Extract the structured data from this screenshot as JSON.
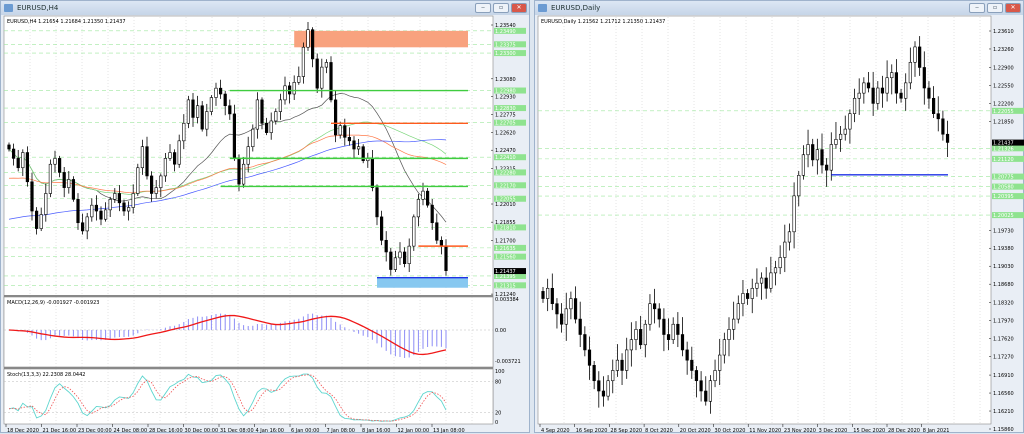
{
  "left": {
    "title": "EURUSD,H4",
    "header": "EURUSD,H4  1.21654 1.21684 1.21350 1.21437",
    "price_labels": [
      "1.23540",
      "1.23080",
      "1.22930",
      "1.22775",
      "1.22620",
      "1.22470",
      "1.22315",
      "1.22010",
      "1.21855",
      "1.21700",
      "1.21240"
    ],
    "price_values": [
      1.2354,
      1.2308,
      1.2293,
      1.22775,
      1.2262,
      1.2247,
      1.22315,
      1.2201,
      1.21855,
      1.217,
      1.2124
    ],
    "level_labels": [
      "1.23490",
      "1.23375",
      "1.23300",
      "1.22980",
      "1.22830",
      "1.22705",
      "1.22410",
      "1.22280",
      "1.22170",
      "1.22055",
      "1.21810",
      "1.21635",
      "1.21560",
      "1.21395",
      "1.21315"
    ],
    "level_values": [
      1.2349,
      1.23375,
      1.233,
      1.2298,
      1.2283,
      1.22705,
      1.2241,
      1.2228,
      1.2217,
      1.22055,
      1.2181,
      1.21635,
      1.2156,
      1.21395,
      1.21315
    ],
    "current_price": "1.21437",
    "closes": [
      1.2248,
      1.224,
      1.2232,
      1.2245,
      1.222,
      1.2195,
      1.218,
      1.2192,
      1.221,
      1.2235,
      1.224,
      1.2228,
      1.2215,
      1.2222,
      1.2205,
      1.2185,
      1.2178,
      1.219,
      1.22,
      1.2195,
      1.2188,
      1.2196,
      1.2205,
      1.221,
      1.2202,
      1.2195,
      1.2198,
      1.221,
      1.2232,
      1.225,
      1.2225,
      1.221,
      1.2215,
      1.2225,
      1.224,
      1.2245,
      1.2235,
      1.2255,
      1.227,
      1.229,
      1.2275,
      1.2285,
      1.2265,
      1.228,
      1.2292,
      1.23,
      1.2295,
      1.2285,
      1.2278,
      1.224,
      1.2218,
      1.2235,
      1.225,
      1.2265,
      1.229,
      1.227,
      1.2262,
      1.2272,
      1.228,
      1.229,
      1.2302,
      1.2295,
      1.2305,
      1.231,
      1.2335,
      1.235,
      1.2325,
      1.23,
      1.2318,
      1.2322,
      1.229,
      1.226,
      1.2268,
      1.2258,
      1.2255,
      1.2248,
      1.225,
      1.2238,
      1.224,
      1.2215,
      1.219,
      1.217,
      1.216,
      1.2145,
      1.2155,
      1.216,
      1.215,
      1.2165,
      1.219,
      1.2205,
      1.2212,
      1.22,
      1.2185,
      1.217,
      1.2165,
      1.2144
    ],
    "zones": [
      {
        "from": 1.2349,
        "to": 1.23375,
        "start": 62,
        "color": "#f8a27e"
      },
      {
        "from": 1.2138,
        "to": 1.2132,
        "start": 80,
        "color": "#87c8f0"
      }
    ],
    "levels": [
      {
        "price": 1.2298,
        "start": 48,
        "color": "#3fcc3f"
      },
      {
        "price": 1.227,
        "start": 70,
        "color": "#ff5a1e"
      },
      {
        "price": 1.224,
        "start": 48,
        "color": "#3fcc3f"
      },
      {
        "price": 1.2216,
        "start": 46,
        "color": "#3fcc3f"
      },
      {
        "price": 1.2165,
        "start": 89,
        "color": "#ff5a1e"
      },
      {
        "price": 1.2138,
        "start": 80,
        "color": "#1e32e6"
      }
    ],
    "macd": {
      "label": "MACD(12,26,9) -0.001927 -0.001923",
      "scale": [
        "0.003384",
        "0.00",
        "-0.003721"
      ]
    },
    "stoch": {
      "label": "Stoch(13,3,3) 22.2308 28.0442",
      "scale": [
        "100",
        "80",
        "20",
        "0"
      ]
    },
    "dates": [
      "18 Dec 2020",
      "21 Dec 16:00",
      "23 Dec 00:00",
      "24 Dec 08:00",
      "28 Dec 16:00",
      "30 Dec 00:00",
      "31 Dec 08:00",
      "4 Jan 16:00",
      "6 Jan 00:00",
      "7 Jan 08:00",
      "8 Jan 16:00",
      "12 Jan 00:00",
      "13 Jan 08:00"
    ]
  },
  "right": {
    "title": "EURUSD,Daily",
    "header": "EURUSD,Daily  1.21562 1.21712 1.21350 1.21437",
    "price_labels": [
      "1.23610",
      "1.23260",
      "1.22900",
      "1.22550",
      "1.22200",
      "1.21850",
      "1.19730",
      "1.19380",
      "1.19030",
      "1.18680",
      "1.18320",
      "1.17970",
      "1.17620",
      "1.17270",
      "1.16910",
      "1.16560",
      "1.16210",
      "1.15860"
    ],
    "price_values": [
      1.2361,
      1.2326,
      1.229,
      1.2255,
      1.222,
      1.2185,
      1.1973,
      1.1938,
      1.1903,
      1.1868,
      1.1832,
      1.1797,
      1.1762,
      1.1727,
      1.1691,
      1.1656,
      1.1621,
      1.1586
    ],
    "level_labels": [
      "1.22055",
      "1.21326",
      "1.21120",
      "1.20775",
      "1.20580",
      "1.20395",
      "1.20025"
    ],
    "level_values": [
      1.22055,
      1.21326,
      1.2112,
      1.20775,
      1.2058,
      1.20395,
      1.20025
    ],
    "current_price": "1.21437",
    "closes": [
      1.184,
      1.186,
      1.183,
      1.181,
      1.179,
      1.182,
      1.184,
      1.18,
      1.177,
      1.174,
      1.171,
      1.168,
      1.166,
      1.165,
      1.168,
      1.17,
      1.172,
      1.17,
      1.174,
      1.176,
      1.178,
      1.175,
      1.179,
      1.183,
      1.182,
      1.18,
      1.177,
      1.176,
      1.179,
      1.177,
      1.174,
      1.172,
      1.17,
      1.168,
      1.166,
      1.164,
      1.168,
      1.17,
      1.173,
      1.176,
      1.178,
      1.18,
      1.183,
      1.185,
      1.184,
      1.186,
      1.187,
      1.188,
      1.186,
      1.189,
      1.19,
      1.192,
      1.195,
      1.197,
      1.204,
      1.208,
      1.212,
      1.214,
      1.211,
      1.213,
      1.21,
      1.209,
      1.214,
      1.215,
      1.216,
      1.217,
      1.22,
      1.223,
      1.224,
      1.226,
      1.225,
      1.222,
      1.225,
      1.224,
      1.227,
      1.228,
      1.224,
      1.223,
      1.226,
      1.23,
      1.233,
      1.229,
      1.225,
      1.223,
      1.22,
      1.219,
      1.216,
      1.2144
    ],
    "levels": [
      {
        "price": 1.2081,
        "start": 62,
        "color": "#1e32e6"
      }
    ],
    "dates": [
      "4 Sep 2020",
      "16 Sep 2020",
      "28 Sep 2020",
      "8 Oct 2020",
      "20 Oct 2020",
      "30 Oct 2020",
      "11 Nov 2020",
      "23 Nov 2020",
      "3 Dec 2020",
      "15 Dec 2020",
      "28 Dec 2020",
      "8 Jan 2021"
    ]
  },
  "window_buttons": {
    "minimize": "‒",
    "maximize": "▫",
    "close": "✕"
  }
}
